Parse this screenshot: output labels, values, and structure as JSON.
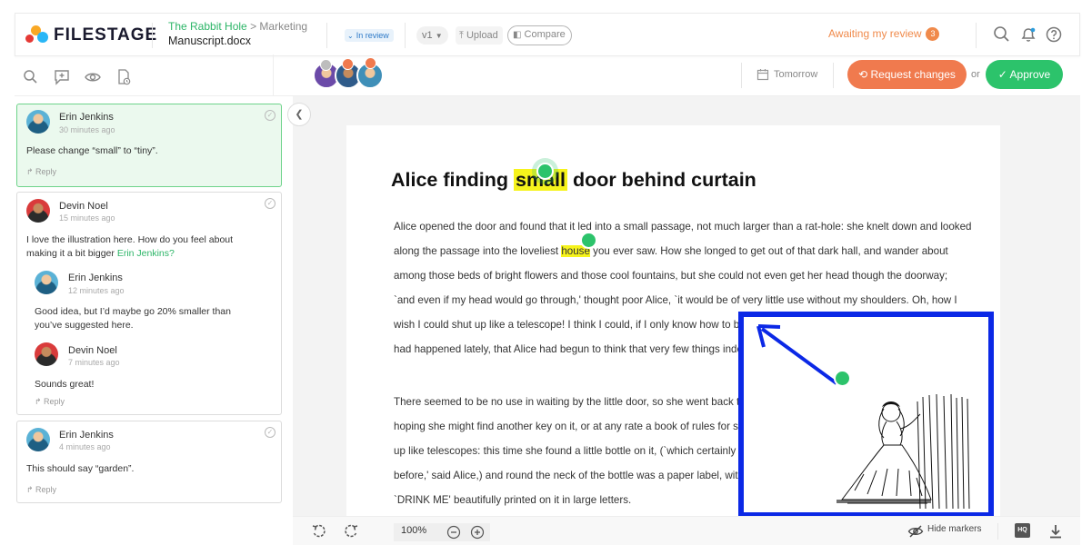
{
  "header": {
    "logo_text": "FILESTAGE",
    "project": "The Rabbit Hole",
    "folder_sep": ">",
    "folder": "Marketing",
    "file_name": "Manuscript.docx",
    "status": "In review",
    "version": "v1",
    "upload_label": "Upload",
    "compare_label": "Compare",
    "awaiting_label": "Awaiting my review",
    "awaiting_count": "3",
    "icons": [
      "search-icon",
      "bell-icon",
      "help-icon"
    ]
  },
  "sidebar": {
    "tools": [
      "search-icon",
      "add-comment-icon",
      "eye-icon",
      "attachment-icon"
    ],
    "comments": [
      {
        "author": "Erin Jenkins",
        "time": "30 minutes ago",
        "text": "Please change “small” to “tiny”.",
        "reply_label": "Reply"
      },
      {
        "author": "Devin Noel",
        "time": "15 minutes ago",
        "text_line1": "I love the illustration here. How do you feel about",
        "text_line2_pre": "making it a bit bigger ",
        "mention": "Erin Jenkins?",
        "replies": [
          {
            "author": "Erin Jenkins",
            "time": "12 minutes ago",
            "text_line1": "Good idea, but I’d maybe go 20% smaller than",
            "text_line2": "you’ve suggested here."
          },
          {
            "author": "Devin Noel",
            "time": "7 minutes ago",
            "text": "Sounds great!"
          }
        ],
        "reply_label": "Reply"
      },
      {
        "author": "Erin Jenkins",
        "time": "4 minutes ago",
        "text": "This should say “garden”.",
        "reply_label": "Reply"
      }
    ]
  },
  "review": {
    "due_label": "Tomorrow",
    "request_changes_label": "Request changes",
    "or_label": "or",
    "approve_label": "Approve"
  },
  "document": {
    "title_pre": "Alice finding ",
    "title_highlight": "small",
    "title_post": " door behind curtain",
    "p1": [
      "Alice opened the door and found that it led into a small passage, not much larger than a rat-hole: she knelt down and looked",
      "along the passage into the loveliest ",
      "house",
      "you ever saw. How she longed to get out of that dark hall, and wander about",
      "among those beds of bright flowers and those cool fountains, but she could not even get her head though the doorway;",
      "`and even if my head would go through,' thought poor Alice, `it would be of very little use without my shoulders. Oh, how I",
      "wish I could shut up like a telescope! I think I could, if I only know how to begin.' For, you see, so many out-of-the-way things",
      "had happened lately, that Alice had begun to think that very few things indeed were really impossible."
    ],
    "p2": [
      "There seemed to be no use in waiting by the little door, so she went back to the table, half",
      "hoping she might find another key on it, or at any rate a book of rules for shutting people",
      "up like telescopes: this time she found a little bottle on it, (`which certainly was not here",
      "before,' said Alice,) and round the neck of the bottle was a paper label, with the words",
      "`DRINK ME' beautifully printed on it in large letters."
    ]
  },
  "toolbar": {
    "zoom": "100%",
    "hide_markers_label": "Hide markers",
    "hq_label": "HQ"
  },
  "colors": {
    "brand_green": "#2cc36b",
    "request_orange": "#f07a4e",
    "highlight_yellow": "#f6f31c",
    "annotation_blue": "#0b28e6"
  }
}
